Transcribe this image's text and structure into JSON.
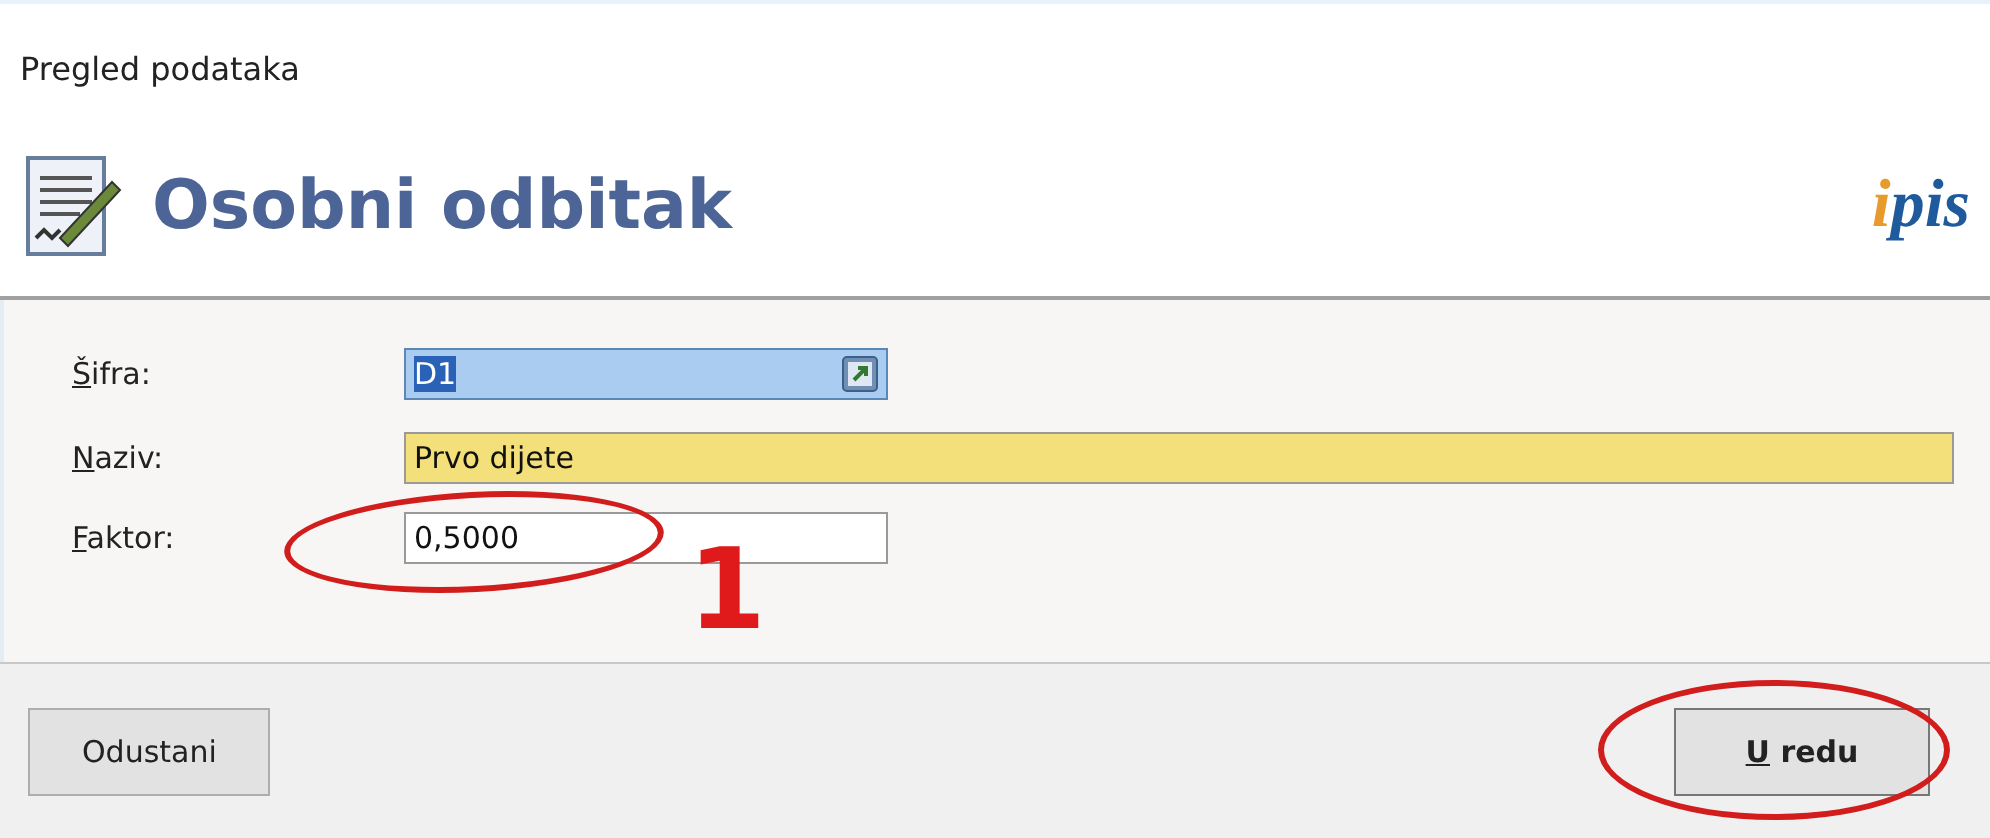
{
  "window": {
    "title": "Pregled podataka"
  },
  "header": {
    "title": "Osobni odbitak",
    "logo": "ipis"
  },
  "fields": [
    {
      "kind": "lookup",
      "label": "Šifra:",
      "first_letter_underlined": true,
      "value": "D1",
      "focused": true,
      "text_selected": true,
      "circled": false
    },
    {
      "kind": "text",
      "label": "Naziv:",
      "first_letter_underlined": true,
      "value": "Prvo dijete",
      "focused": false,
      "text_selected": false,
      "required": true,
      "circled": false
    },
    {
      "kind": "text",
      "label": "Faktor:",
      "first_letter_underlined": true,
      "value": "0,5000",
      "focused": false,
      "text_selected": false,
      "required": false,
      "circled": true
    }
  ],
  "annotation_label": "1",
  "buttons": [
    {
      "label": "Odustani",
      "first_letter_underlined": false,
      "default": false,
      "circled": false
    },
    {
      "label": "U redu",
      "first_letter_underlined": true,
      "default": true,
      "circled": true
    }
  ]
}
